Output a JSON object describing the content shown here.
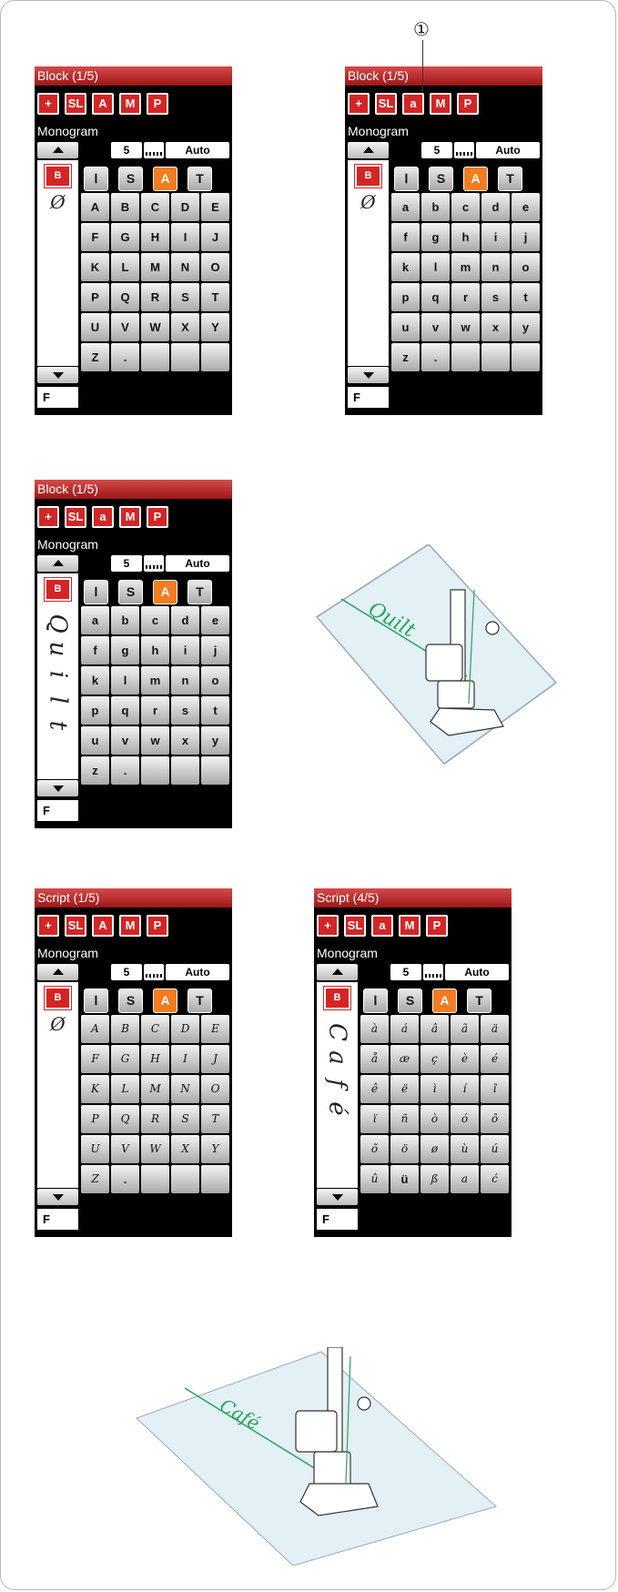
{
  "screens": [
    {
      "title": "Block (1/5)",
      "monogram": "Monogram",
      "toolbar": [
        "+",
        "SL",
        "A",
        "M",
        "P"
      ],
      "status": {
        "foot_height": "5",
        "tension": "Auto"
      },
      "categories": [
        "Ⅰ",
        "S",
        "A",
        "T"
      ],
      "preview_glyphs": [
        "Ø"
      ],
      "keys": [
        "A",
        "B",
        "C",
        "D",
        "E",
        "F",
        "G",
        "H",
        "I",
        "J",
        "K",
        "L",
        "M",
        "N",
        "O",
        "P",
        "Q",
        "R",
        "S",
        "T",
        "U",
        "V",
        "W",
        "X",
        "Y",
        "Z",
        ".",
        "",
        "",
        ""
      ],
      "footer": "F"
    },
    {
      "title": "Block (1/5)",
      "monogram": "Monogram",
      "toolbar": [
        "+",
        "SL",
        "a",
        "M",
        "P"
      ],
      "status": {
        "foot_height": "5",
        "tension": "Auto"
      },
      "categories": [
        "Ⅰ",
        "S",
        "A",
        "T"
      ],
      "preview_glyphs": [
        "Ø"
      ],
      "keys": [
        "a",
        "b",
        "c",
        "d",
        "e",
        "f",
        "g",
        "h",
        "i",
        "j",
        "k",
        "l",
        "m",
        "n",
        "o",
        "p",
        "q",
        "r",
        "s",
        "t",
        "u",
        "v",
        "w",
        "x",
        "y",
        "z",
        ".",
        "",
        "",
        ""
      ],
      "footer": "F"
    },
    {
      "title": "Block (1/5)",
      "monogram": "Monogram",
      "toolbar": [
        "+",
        "SL",
        "a",
        "M",
        "P"
      ],
      "status": {
        "foot_height": "5",
        "tension": "Auto"
      },
      "categories": [
        "Ⅰ",
        "S",
        "A",
        "T"
      ],
      "preview_glyphs": [
        "Q",
        "u",
        "i",
        "l",
        "t"
      ],
      "keys": [
        "a",
        "b",
        "c",
        "d",
        "e",
        "f",
        "g",
        "h",
        "i",
        "j",
        "k",
        "l",
        "m",
        "n",
        "o",
        "p",
        "q",
        "r",
        "s",
        "t",
        "u",
        "v",
        "w",
        "x",
        "y",
        "z",
        ".",
        "",
        "",
        ""
      ],
      "footer": "F"
    },
    {
      "title": "Script (1/5)",
      "monogram": "Monogram",
      "toolbar": [
        "+",
        "SL",
        "A",
        "M",
        "P"
      ],
      "status": {
        "foot_height": "5",
        "tension": "Auto"
      },
      "categories": [
        "Ⅰ",
        "S",
        "A",
        "T"
      ],
      "preview_glyphs": [
        "Ø"
      ],
      "keys": [
        "A",
        "B",
        "C",
        "D",
        "E",
        "F",
        "G",
        "H",
        "I",
        "J",
        "K",
        "L",
        "M",
        "N",
        "O",
        "P",
        "Q",
        "R",
        "S",
        "T",
        "U",
        "V",
        "W",
        "X",
        "Y",
        "Z",
        ".",
        "",
        "",
        ""
      ],
      "footer": "F"
    },
    {
      "title": "Script (4/5)",
      "monogram": "Monogram",
      "toolbar": [
        "+",
        "SL",
        "a",
        "M",
        "P"
      ],
      "status": {
        "foot_height": "5",
        "tension": "Auto"
      },
      "categories": [
        "Ⅰ",
        "S",
        "A",
        "T"
      ],
      "preview_glyphs": [
        "C",
        "a",
        "f",
        "é"
      ],
      "keys": [
        "à",
        "á",
        "â",
        "ã",
        "ä",
        "å",
        "æ",
        "ç",
        "è",
        "é",
        "ê",
        "ë",
        "ì",
        "í",
        "î",
        "ï",
        "ñ",
        "ò",
        "ó",
        "ô",
        "õ",
        "ö",
        "ø",
        "ù",
        "ú",
        "û",
        "ü",
        "ß",
        "a",
        "ć"
      ],
      "footer": "F"
    }
  ],
  "callout": "①",
  "illustrations": [
    {
      "stitched_text": "Quilt"
    },
    {
      "stitched_text": "Café"
    }
  ],
  "colors": {
    "accent": "#d42525",
    "selected": "#f47c20",
    "stitch": "#2aa35a",
    "fabric": "#e3f0f6"
  }
}
